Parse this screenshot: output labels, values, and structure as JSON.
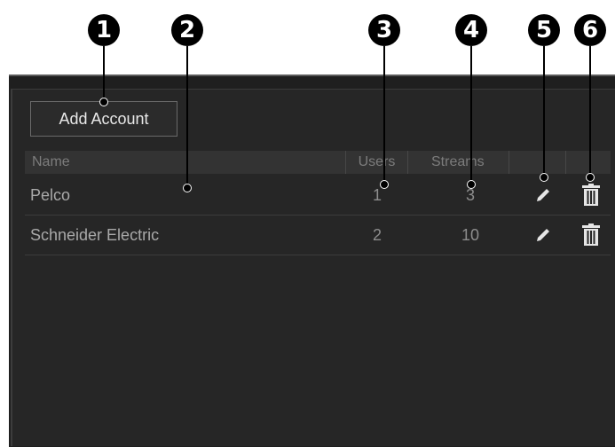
{
  "callouts": [
    "1",
    "2",
    "3",
    "4",
    "5",
    "6"
  ],
  "toolbar": {
    "add_label": "Add Account"
  },
  "table": {
    "columns": [
      "Name",
      "Users",
      "Streams",
      "",
      ""
    ],
    "rows": [
      {
        "name": "Pelco",
        "users": "1",
        "streams": "3",
        "edit_icon": "pencil-icon",
        "delete_icon": "trash-icon"
      },
      {
        "name": "Schneider Electric",
        "users": "2",
        "streams": "10",
        "edit_icon": "pencil-icon",
        "delete_icon": "trash-icon"
      }
    ]
  },
  "colors": {
    "panel": "#1f1f1f",
    "text": "#a9a9a9",
    "header": "#333333",
    "icon": "#e6e6e6"
  }
}
